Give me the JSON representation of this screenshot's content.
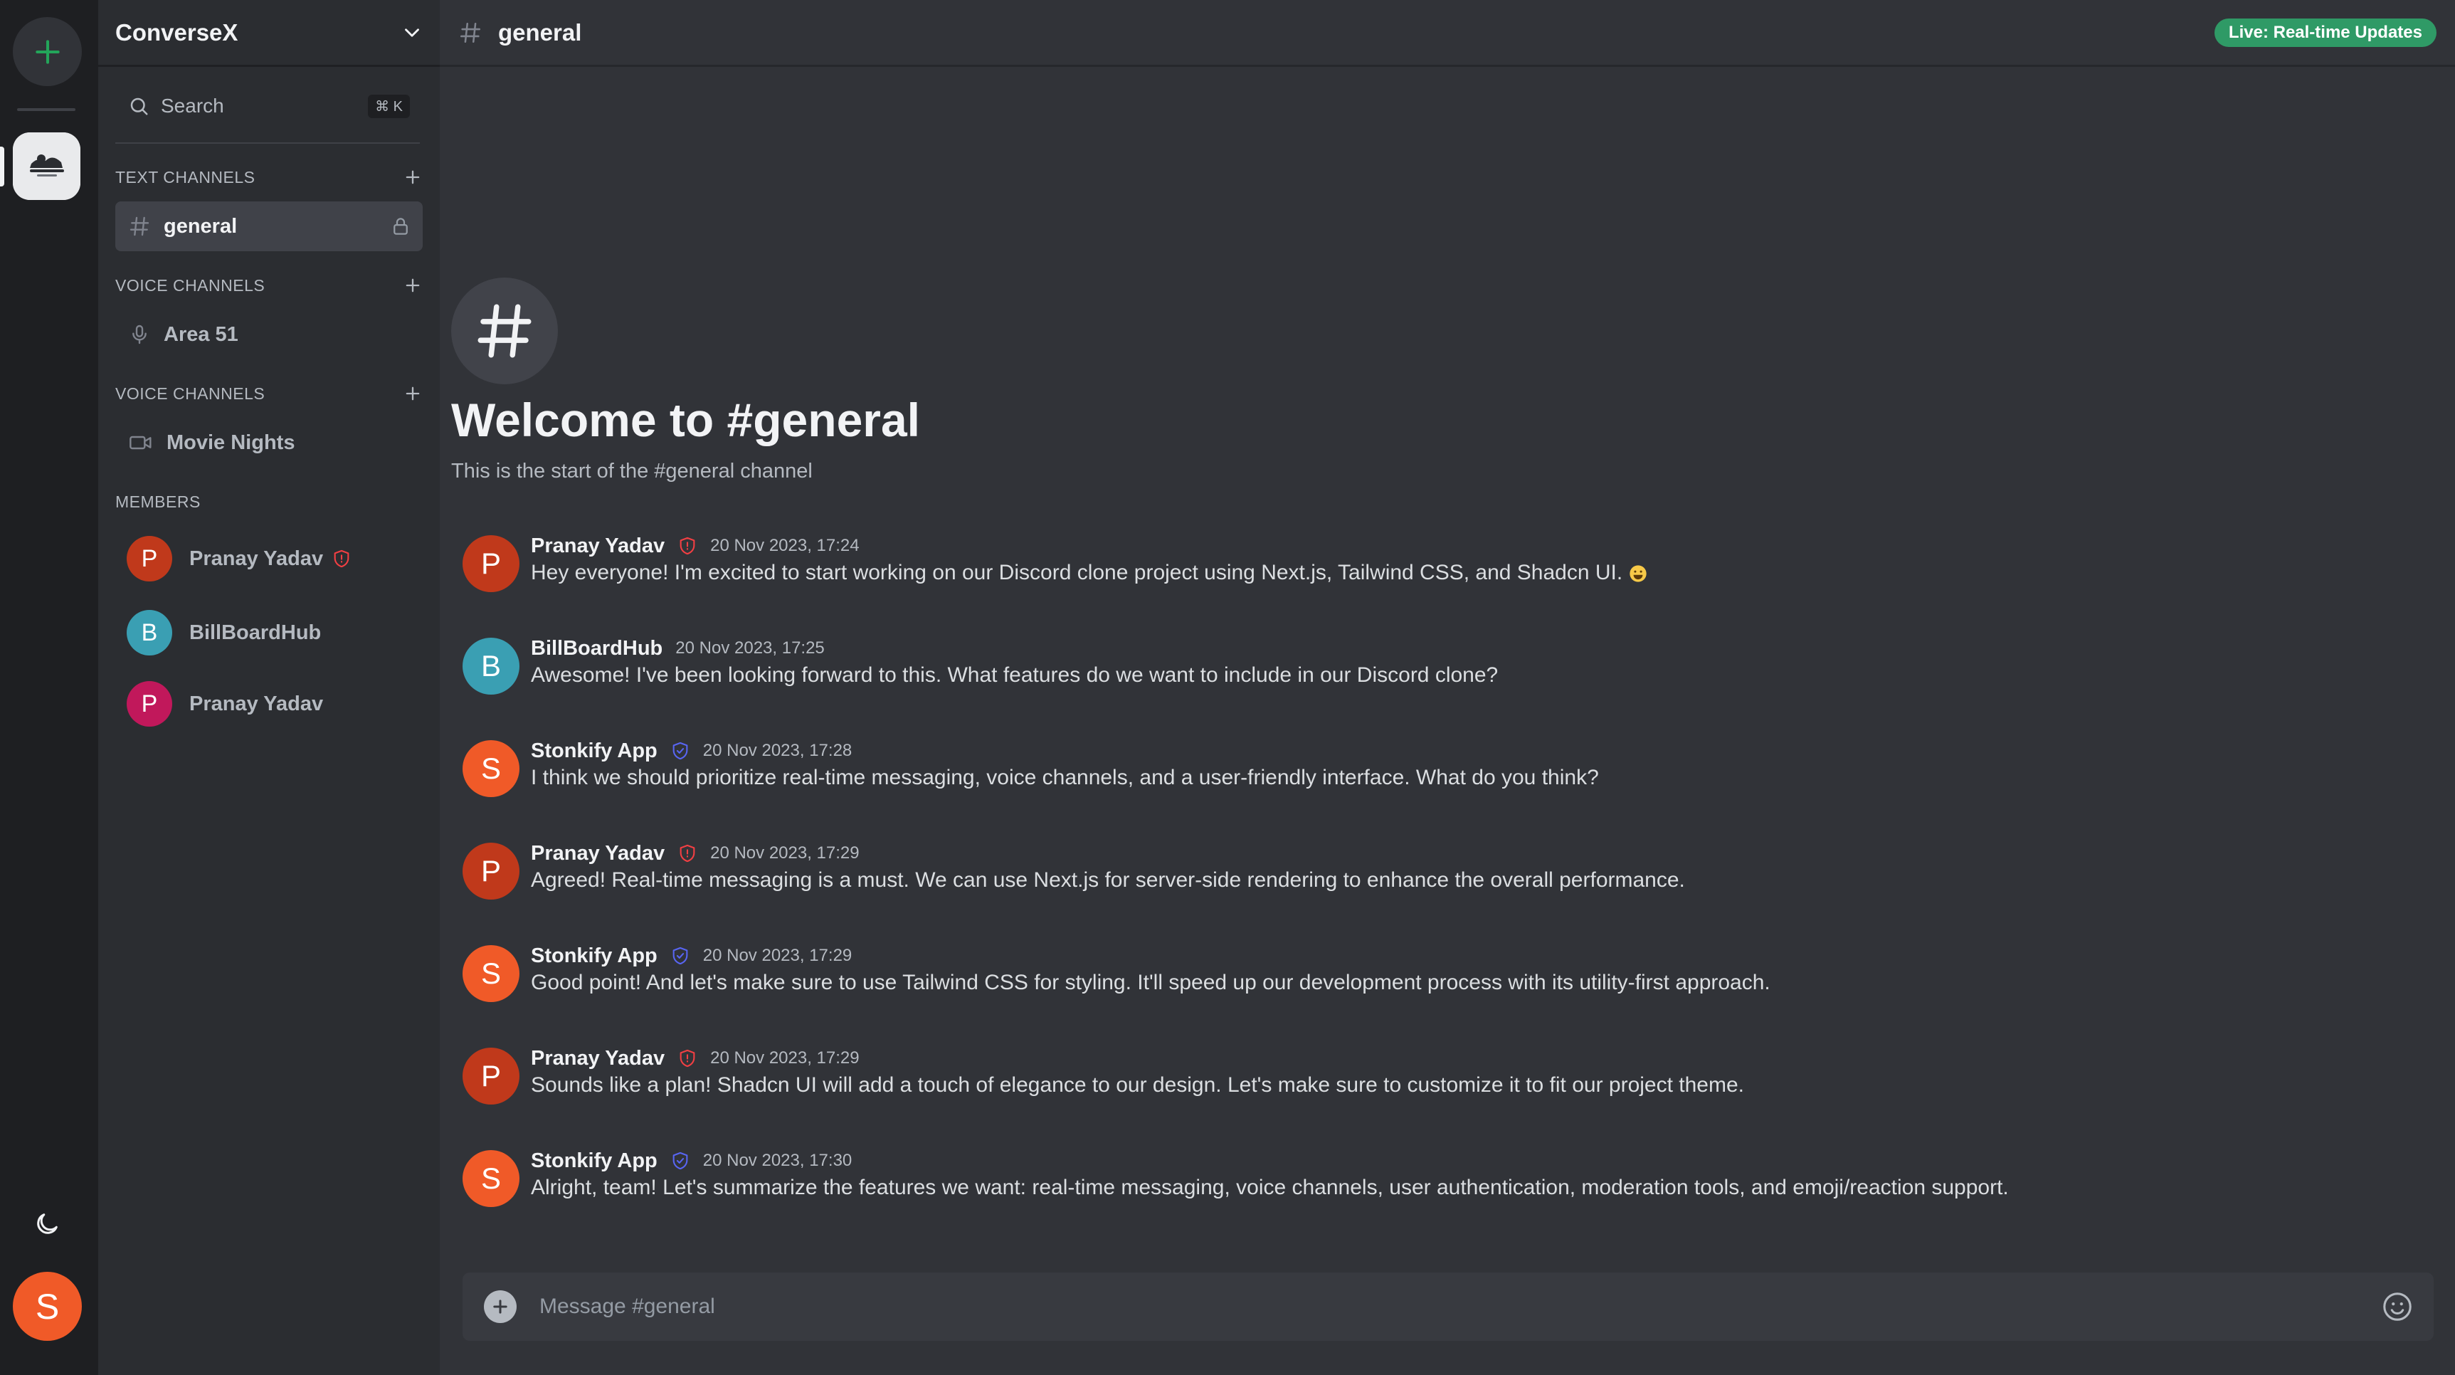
{
  "rail": {
    "add_icon": "plus-icon",
    "server_icon": "server-logo",
    "theme_icon": "moon-icon",
    "user_initial": "S",
    "user_color": "#f05a28"
  },
  "sidebar": {
    "server_name": "ConverseX",
    "search_label": "Search",
    "search_shortcut": "⌘ K",
    "sections": {
      "text": {
        "title": "TEXT CHANNELS",
        "channels": [
          {
            "name": "general",
            "icon": "hash-icon",
            "locked": true,
            "active": true
          }
        ]
      },
      "voice": {
        "title": "VOICE CHANNELS",
        "channels": [
          {
            "name": "Area 51",
            "icon": "mic-icon"
          }
        ]
      },
      "video": {
        "title": "VOICE CHANNELS",
        "channels": [
          {
            "name": "Movie Nights",
            "icon": "video-icon"
          }
        ]
      }
    },
    "members_title": "MEMBERS",
    "members": [
      {
        "initial": "P",
        "name": "Pranay Yadav",
        "color": "#c0391b",
        "badge": "shield-alert-icon"
      },
      {
        "initial": "B",
        "name": "BillBoardHub",
        "color": "#3a9fb3",
        "badge": ""
      },
      {
        "initial": "P",
        "name": "Pranay Yadav",
        "color": "#c1185b",
        "badge": ""
      }
    ]
  },
  "header": {
    "channel_icon": "hash-icon",
    "channel_name": "general",
    "live_badge": "Live: Real-time Updates",
    "live_color": "#2f9a66"
  },
  "welcome": {
    "title": "Welcome to #general",
    "subtitle": "This is the start of the #general channel"
  },
  "messages": [
    {
      "initial": "P",
      "color": "#c0391b",
      "author": "Pranay Yadav",
      "badge": "shield-alert-icon",
      "time": "20 Nov 2023, 17:24",
      "text": "Hey everyone! I'm excited to start working on our Discord clone project using Next.js, Tailwind CSS, and Shadcn UI.",
      "emoji": "grinning-face-emoji"
    },
    {
      "initial": "B",
      "color": "#3a9fb3",
      "author": "BillBoardHub",
      "badge": "",
      "time": "20 Nov 2023, 17:25",
      "text": "Awesome! I've been looking forward to this. What features do we want to include in our Discord clone?"
    },
    {
      "initial": "S",
      "color": "#f05a28",
      "author": "Stonkify App",
      "badge": "shield-check-icon",
      "time": "20 Nov 2023, 17:28",
      "text": "I think we should prioritize real-time messaging, voice channels, and a user-friendly interface. What do you think?"
    },
    {
      "initial": "P",
      "color": "#c0391b",
      "author": "Pranay Yadav",
      "badge": "shield-alert-icon",
      "time": "20 Nov 2023, 17:29",
      "text": "Agreed! Real-time messaging is a must. We can use Next.js for server-side rendering to enhance the overall performance."
    },
    {
      "initial": "S",
      "color": "#f05a28",
      "author": "Stonkify App",
      "badge": "shield-check-icon",
      "time": "20 Nov 2023, 17:29",
      "text": "Good point! And let's make sure to use Tailwind CSS for styling. It'll speed up our development process with its utility-first approach."
    },
    {
      "initial": "P",
      "color": "#c0391b",
      "author": "Pranay Yadav",
      "badge": "shield-alert-icon",
      "time": "20 Nov 2023, 17:29",
      "text": "Sounds like a plan! Shadcn UI will add a touch of elegance to our design. Let's make sure to customize it to fit our project theme."
    },
    {
      "initial": "S",
      "color": "#f05a28",
      "author": "Stonkify App",
      "badge": "shield-check-icon",
      "time": "20 Nov 2023, 17:30",
      "text": "Alright, team! Let's summarize the features we want: real-time messaging, voice channels, user authentication, moderation tools, and emoji/reaction support."
    }
  ],
  "composer": {
    "placeholder": "Message #general",
    "add_icon": "plus-circle-icon",
    "emoji_icon": "smile-icon"
  }
}
